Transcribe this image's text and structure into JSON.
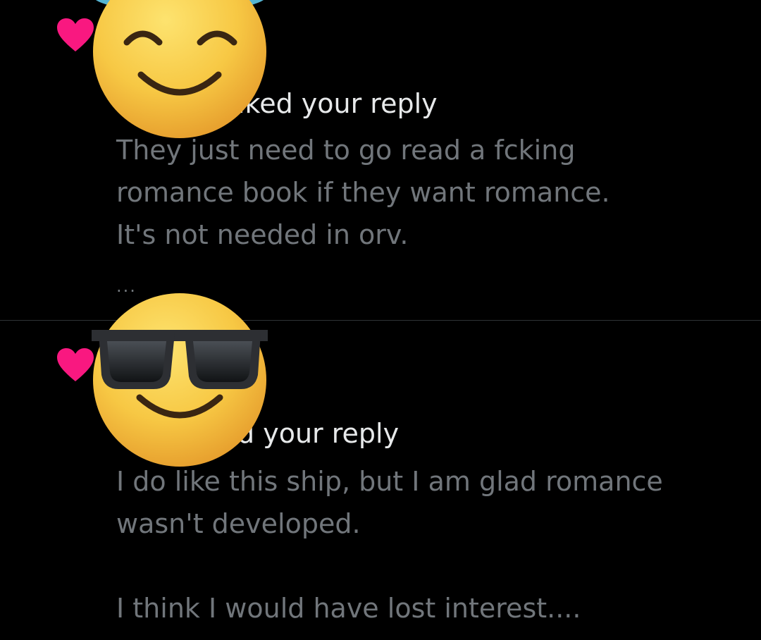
{
  "notifications": [
    {
      "headline": "liked your reply",
      "headline_visible": "iked your reply",
      "reply_text": "They just need to go read a fcking\nromance book if they want romance.\nIt's not needed in orv.",
      "truncation": "...",
      "avatar_icon": "smiling-face-with-halo-icon"
    },
    {
      "headline": "liked your reply",
      "headline_visible": "d your reply",
      "reply_text": "I do like this ship, but I am glad romance\nwasn't developed.\n\nI think I would have lost interest....",
      "avatar_icon": "smiling-face-with-sunglasses-icon"
    }
  ],
  "colors": {
    "background": "#000000",
    "heart": "#f91880",
    "primary_text": "#e7e9ea",
    "secondary_text": "#71767b",
    "divider": "#2f3336",
    "halo": "#5ec8e8",
    "emoji_face": "#f7c844"
  }
}
